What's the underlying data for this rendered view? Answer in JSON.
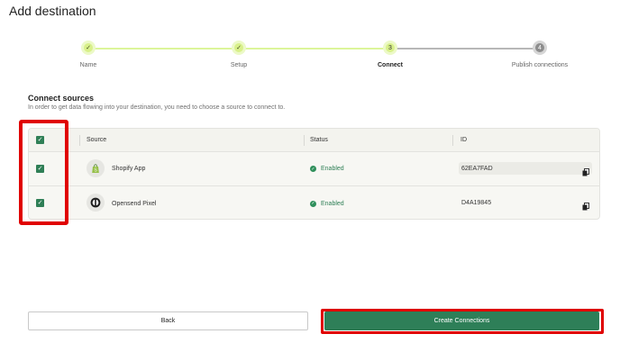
{
  "page": {
    "title": "Add destination"
  },
  "stepper": {
    "steps": [
      {
        "label": "Name",
        "marker": "✓",
        "state": "done"
      },
      {
        "label": "Setup",
        "marker": "✓",
        "state": "done"
      },
      {
        "label": "Connect",
        "marker": "3",
        "state": "current"
      },
      {
        "label": "Publish connections",
        "marker": "4",
        "state": "todo"
      }
    ]
  },
  "section": {
    "title": "Connect sources",
    "description": "In order to get data flowing into your destination, you need to choose a source to connect to."
  },
  "table": {
    "columns": {
      "source": "Source",
      "status": "Status",
      "id": "ID"
    },
    "header_checked": true,
    "rows": [
      {
        "checked": true,
        "source": "Shopify App",
        "icon": "shopify-bag-icon",
        "status": "Enabled",
        "id": "62EA7FAD"
      },
      {
        "checked": true,
        "source": "Opensend Pixel",
        "icon": "opensend-logo-icon",
        "status": "Enabled",
        "id": "D4A19845"
      }
    ]
  },
  "buttons": {
    "back": "Back",
    "create": "Create Connections"
  },
  "colors": {
    "accent_green": "#2e7f58",
    "step_done": "#d8f08a",
    "highlight_red": "#e00000"
  }
}
